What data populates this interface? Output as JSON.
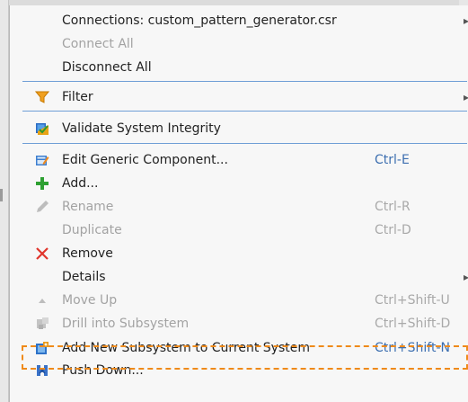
{
  "menu": {
    "connections": {
      "label": "Connections: custom_pattern_generator.csr",
      "arrow": "▸"
    },
    "connect_all": {
      "label": "Connect All"
    },
    "disconnect_all": {
      "label": "Disconnect All"
    },
    "filter": {
      "label": "Filter",
      "arrow": "▸"
    },
    "validate": {
      "label": "Validate System Integrity"
    },
    "edit_generic": {
      "label": "Edit Generic Component...",
      "shortcut": "Ctrl-E"
    },
    "add": {
      "label": "Add..."
    },
    "rename": {
      "label": "Rename",
      "shortcut": "Ctrl-R"
    },
    "duplicate": {
      "label": "Duplicate",
      "shortcut": "Ctrl-D"
    },
    "remove": {
      "label": "Remove"
    },
    "details": {
      "label": "Details",
      "arrow": "▸"
    },
    "move_up": {
      "label": "Move Up",
      "shortcut": "Ctrl+Shift-U"
    },
    "drill_into": {
      "label": "Drill into Subsystem",
      "shortcut": "Ctrl+Shift-D"
    },
    "add_new_subsystem": {
      "label": "Add New Subsystem to Current System",
      "shortcut": "Ctrl+Shift-N"
    },
    "push_down": {
      "label": "Push Down..."
    }
  },
  "icons": {
    "filter": "filter-funnel-icon",
    "validate": "validate-system-icon",
    "edit_generic": "edit-component-icon",
    "add": "plus-icon",
    "rename": "pencil-icon",
    "remove": "x-icon",
    "move_up": "triangle-up-icon",
    "drill_into": "drill-subsystem-icon",
    "add_new_subsystem": "add-subsystem-icon",
    "push_down": "push-down-icon"
  },
  "colors": {
    "menu_bg": "#f7f7f7",
    "separator": "#6f9ed6",
    "shortcut": "#3d6fb0",
    "disabled_text": "#a3a3a3",
    "highlight_border": "#ef8a1a"
  }
}
